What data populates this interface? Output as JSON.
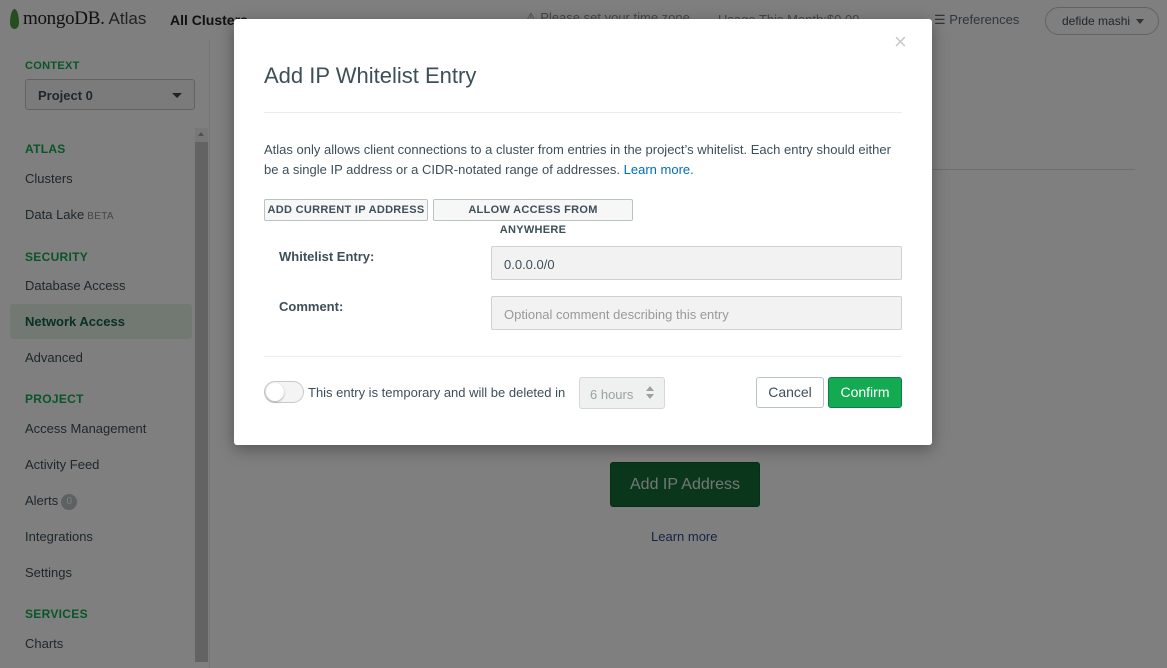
{
  "topbar": {
    "logo_text": "mongoDB.",
    "logo_atlas": "Atlas",
    "clusters": "All Clusters",
    "timezone": "Please set your time zone",
    "usage": "Usage This Month:$0.00",
    "preferences": "Preferences",
    "user": "defide mashi"
  },
  "sidebar": {
    "context_label": "CONTEXT",
    "context_value": "Project 0",
    "sections": {
      "atlas": "ATLAS",
      "security": "SECURITY",
      "project": "PROJECT",
      "services": "SERVICES"
    },
    "items": {
      "clusters": "Clusters",
      "data_lake": "Data Lake",
      "beta": "BETA",
      "database_access": "Database Access",
      "network_access": "Network Access",
      "advanced": "Advanced",
      "access_management": "Access Management",
      "activity_feed": "Activity Feed",
      "alerts": "Alerts",
      "alerts_count": "0",
      "integrations": "Integrations",
      "settings": "Settings",
      "charts": "Charts"
    }
  },
  "main": {
    "add_ip_button": "Add IP Address",
    "learn_more": "Learn more"
  },
  "modal": {
    "title": "Add IP Whitelist Entry",
    "description": "Atlas only allows client connections to a cluster from entries in the project’s whitelist. Each entry should either be a single IP address or a CIDR-notated range of addresses.",
    "learn_more": "Learn more.",
    "add_current_ip": "ADD CURRENT IP ADDRESS",
    "allow_anywhere": "ALLOW ACCESS FROM ANYWHERE",
    "whitelist_label": "Whitelist Entry:",
    "whitelist_value": "0.0.0.0/0",
    "comment_label": "Comment:",
    "comment_placeholder": "Optional comment describing this entry",
    "temporary_text": "This entry is temporary and will be deleted in",
    "hours_value": "6 hours",
    "cancel": "Cancel",
    "confirm": "Confirm"
  },
  "colors": {
    "brand_green": "#13aa52",
    "link_blue": "#006cbc",
    "text": "#3d4f58"
  }
}
